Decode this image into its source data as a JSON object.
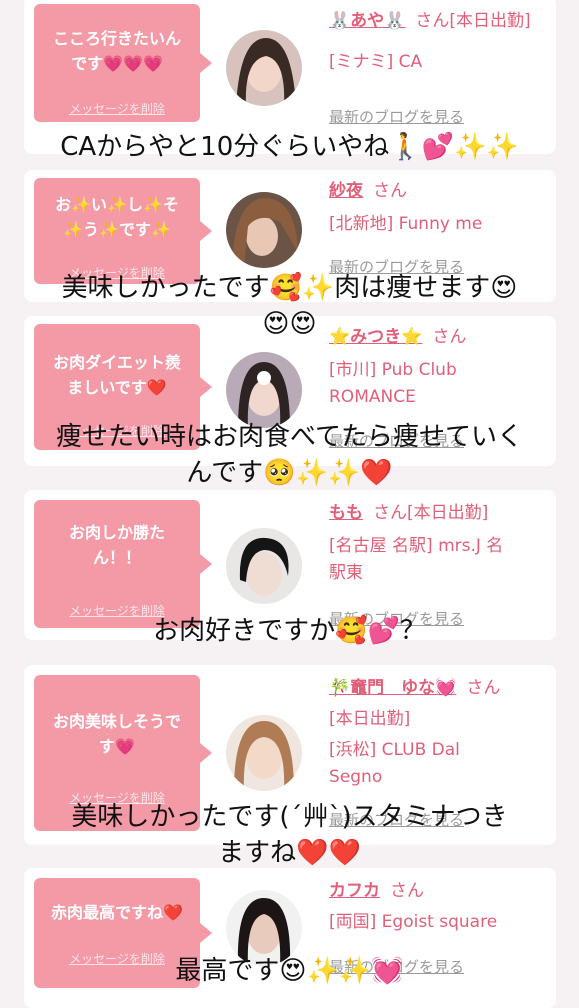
{
  "delete_label": "メッセージを削除",
  "blog_label": "最新のブログを見る",
  "cards": [
    {
      "comment": "こころ行きたいんです💗💗💗",
      "name": "🐰あや🐰",
      "suffix": "さん[本日出勤]",
      "lines": [
        "[ミナミ] CA"
      ],
      "overlay": [
        "CAからやと10分ぐらいやね🚶💕✨✨"
      ]
    },
    {
      "comment": "お✨い✨し✨そ✨う✨です✨",
      "name": "紗夜",
      "suffix": "さん",
      "lines": [
        "[北新地] Funny me"
      ],
      "overlay": [
        "美味しかったです🥰✨肉は痩せます😍",
        "😍😍"
      ]
    },
    {
      "comment": "お肉ダイエット羨ましいです❤️",
      "name": "⭐️みつき⭐️",
      "suffix": "さん",
      "lines": [
        "[市川] Pub Club",
        "ROMANCE"
      ],
      "overlay": [
        "痩せたい時はお肉食べてたら痩せていく",
        "んです🥺✨✨❤️"
      ]
    },
    {
      "comment": "お肉しか勝たん！！",
      "name": "もも",
      "suffix": "さん[本日出勤]",
      "lines": [
        "[名古屋 名駅] mrs.J 名",
        "駅東"
      ],
      "overlay": [
        "お肉好きですか🥰💕？"
      ]
    },
    {
      "comment": "お肉美味しそうです💗",
      "name": "🎋竈門　ゆな💓",
      "suffix": "さん",
      "lines": [
        "[本日出勤]",
        "[浜松] CLUB Dal",
        "Segno"
      ],
      "overlay": [
        "美味しかったです(´艸`)スタミナつき",
        "ますね❤️❤️"
      ]
    },
    {
      "comment": "赤肉最高ですね❤️",
      "name": "カフカ",
      "suffix": "さん",
      "lines": [
        "[両国] Egoist square"
      ],
      "overlay": [
        "最高です😍✨✨💓"
      ]
    }
  ]
}
